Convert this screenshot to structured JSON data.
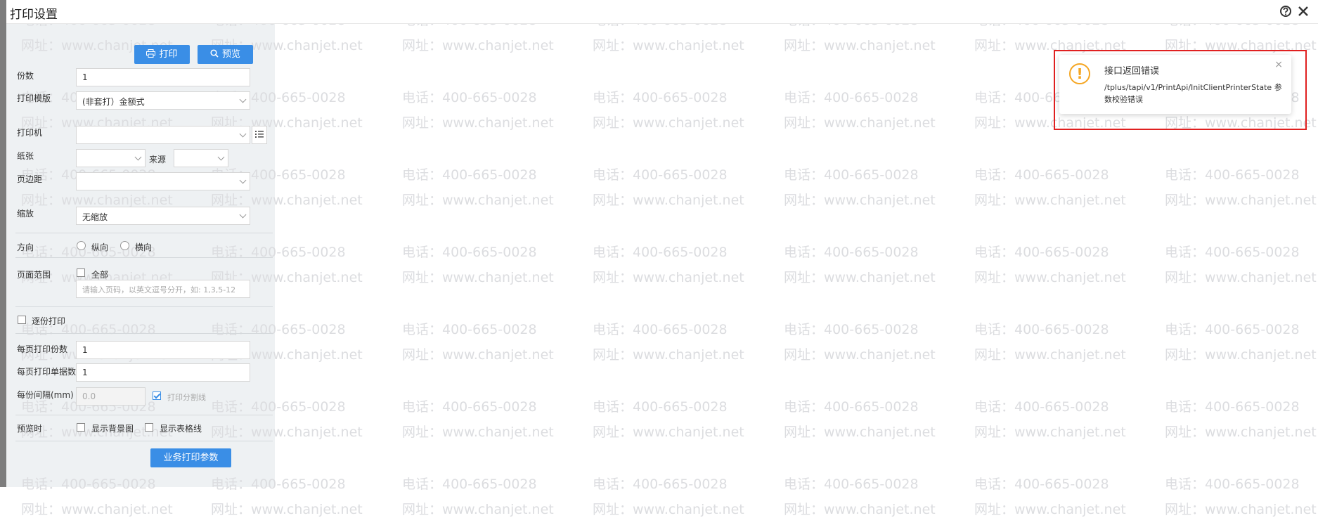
{
  "window": {
    "title": "打印设置",
    "help_icon": "help-circle-icon",
    "close_icon": "close-icon"
  },
  "toolbar": {
    "print_label": "打印",
    "print_icon": "printer-icon",
    "preview_label": "预览",
    "preview_icon": "search-icon"
  },
  "form": {
    "copies": {
      "label": "份数",
      "value": "1"
    },
    "template": {
      "label": "打印模版",
      "value": "(非套打）金额式"
    },
    "printer": {
      "label": "打印机",
      "value": "",
      "list_icon": "list-icon"
    },
    "paper": {
      "label": "纸张",
      "value": ""
    },
    "source": {
      "label": "来源",
      "value": ""
    },
    "margin": {
      "label": "页边距",
      "value": ""
    },
    "scale": {
      "label": "缩放",
      "value": "无缩放"
    },
    "orientation": {
      "label": "方向",
      "portrait": "纵向",
      "landscape": "横向"
    },
    "page_range": {
      "label": "页面范围",
      "all": "全部",
      "placeholder": "请输入页码，以英文逗号分开，如: 1,3,5-12"
    },
    "collate": {
      "label": "逐份打印"
    },
    "copies_per_page": {
      "label": "每页打印份数",
      "value": "1"
    },
    "docs_per_page": {
      "label": "每页打印单据数",
      "value": "1"
    },
    "interval": {
      "label": "每份间隔(mm)",
      "value": "0.0",
      "separator_label": "打印分割线"
    },
    "preview_when": {
      "label": "预览时",
      "show_bg": "显示背景图",
      "show_grid": "显示表格线"
    },
    "business_params_label": "业务打印参数"
  },
  "watermark": {
    "phone": "电话：400-665-0028",
    "site": "网址：www.chanjet.net"
  },
  "toast": {
    "icon": "warning-icon",
    "title": "接口返回错误",
    "message": "/tplus/tapi/v1/PrintApi/InitClientPrinterState 参数校验错误",
    "close": "×",
    "highlight_color": "#e02020"
  }
}
